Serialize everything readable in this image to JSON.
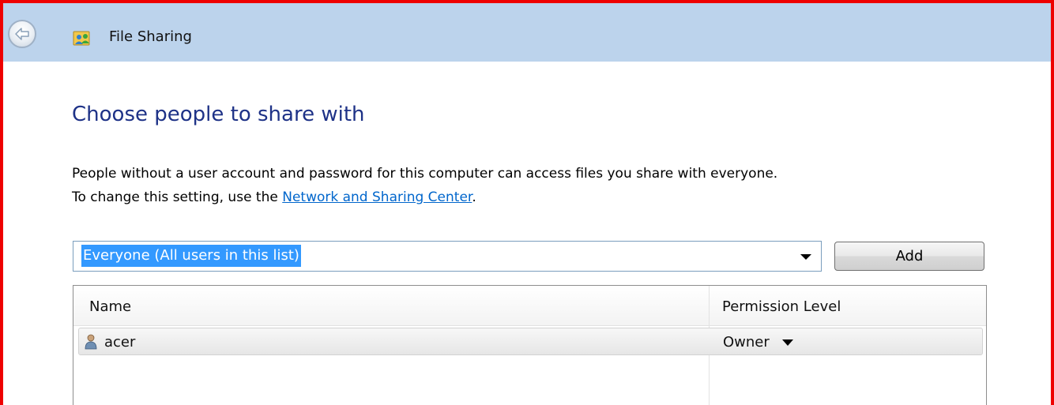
{
  "window": {
    "title": "File Sharing",
    "back_icon": "back-arrow-icon",
    "app_icon": "people-sharing-icon"
  },
  "main": {
    "heading": "Choose people to share with",
    "description_line1": "People without a user account and password for this computer can access files you share with everyone.",
    "description_line2_prefix": "To change this setting, use the ",
    "description_link": "Network and Sharing Center",
    "description_line2_suffix": "."
  },
  "user_picker": {
    "selected_value": "Everyone (All users in this list)",
    "add_label": "Add"
  },
  "share_list": {
    "columns": [
      "Name",
      "Permission Level"
    ],
    "rows": [
      {
        "name": "acer",
        "permission": "Owner",
        "icon": "user-icon"
      }
    ]
  },
  "colors": {
    "accent": "#1e3287",
    "link": "#0066cc",
    "selection": "#3399ff",
    "titlebar": "#bcd3ec",
    "frame_border": "#ee0000"
  }
}
